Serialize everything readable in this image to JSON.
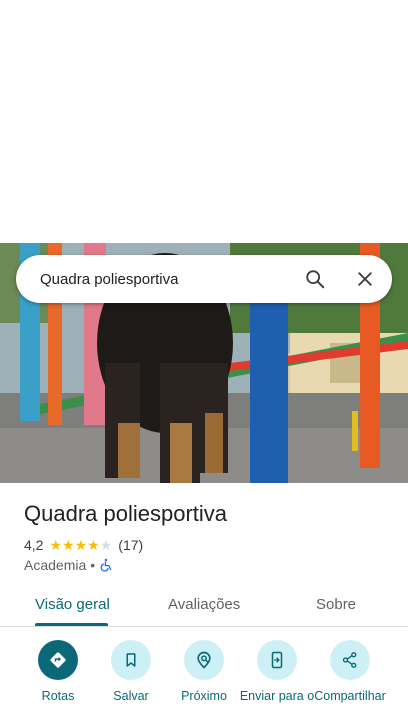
{
  "search": {
    "query": "Quadra poliesportiva"
  },
  "place": {
    "title": "Quadra poliesportiva",
    "rating": "4,2",
    "stars_filled": 4,
    "stars_total": 5,
    "review_count": "(17)",
    "category": "Academia",
    "separator": "•",
    "accessibility_icon": "wheelchair-icon"
  },
  "tabs": [
    {
      "label": "Visão geral",
      "active": true
    },
    {
      "label": "Avaliações",
      "active": false
    },
    {
      "label": "Sobre",
      "active": false
    }
  ],
  "actions": [
    {
      "label": "Rotas",
      "icon": "directions-icon"
    },
    {
      "label": "Salvar",
      "icon": "bookmark-icon"
    },
    {
      "label": "Próximo",
      "icon": "nearby-icon"
    },
    {
      "label": "Enviar para o",
      "icon": "send-to-phone-icon"
    },
    {
      "label": "Compartilhar",
      "icon": "share-icon"
    }
  ],
  "colors": {
    "accent": "#0b6977",
    "action_bg": "#cdf0f6",
    "star": "#fbbc04",
    "star_empty": "#dadce0",
    "wheelchair": "#1a73e8"
  }
}
